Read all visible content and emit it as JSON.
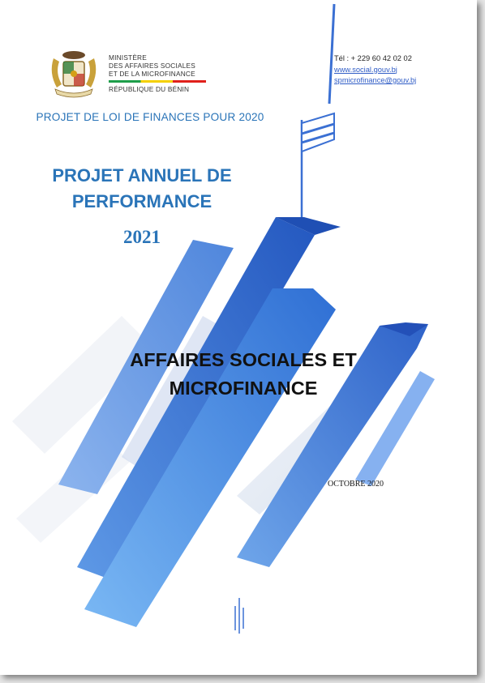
{
  "ministry": {
    "line1": "MINISTÈRE",
    "line2": "DES AFFAIRES SOCIALES",
    "line3": "ET DE LA MICROFINANCE",
    "republic": "RÉPUBLIQUE DU BÉNIN",
    "emblem_icon": "benin-coat-of-arms-icon",
    "flag_colors": [
      "#1e9e4a",
      "#f5d000",
      "#e0201b"
    ]
  },
  "contact": {
    "phone": "Tél : + 229 60 42 02 02",
    "website": "www.social.gouv.bj",
    "email": "spmicrofinance@gouv.bj"
  },
  "header": {
    "law_project": "PROJET DE LOI DE FINANCES POUR 2020"
  },
  "cover": {
    "annual_line1": "PROJET ANNUEL DE",
    "annual_line2": "PERFORMANCE",
    "year": "2021",
    "title_line1": "AFFAIRES SOCIALES ET",
    "title_line2": "MICROFINANCE",
    "date": "OCTOBRE 2020"
  },
  "colors": {
    "accent_blue": "#2a74b8",
    "link_blue": "#2f5cc6",
    "deco_blue": "#3f7fd9"
  }
}
